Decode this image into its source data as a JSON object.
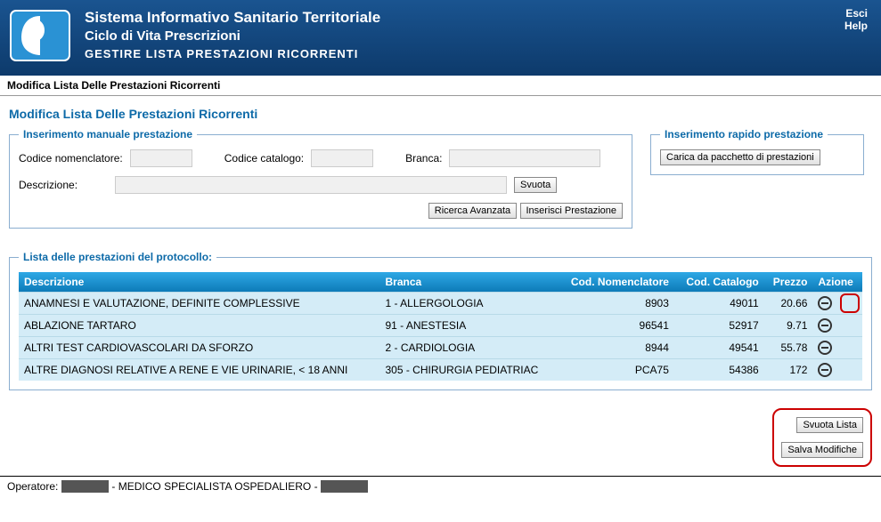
{
  "header": {
    "title": "Sistema Informativo Sanitario Territoriale",
    "subtitle": "Ciclo di Vita Prescrizioni",
    "section": "GESTIRE LISTA PRESTAZIONI RICORRENTI",
    "exit": "Esci",
    "help": "Help"
  },
  "breadcrumb": "Modifica Lista Delle Prestazioni Ricorrenti",
  "page_title": "Modifica Lista Delle Prestazioni Ricorrenti",
  "insert": {
    "legend": "Inserimento manuale prestazione",
    "codice_nomenclatore_label": "Codice nomenclatore:",
    "codice_catalogo_label": "Codice catalogo:",
    "branca_label": "Branca:",
    "descrizione_label": "Descrizione:",
    "svuota": "Svuota",
    "ricerca_avanzata": "Ricerca Avanzata",
    "inserisci_prestazione": "Inserisci Prestazione"
  },
  "rapido": {
    "legend": "Inserimento rapido prestazione",
    "carica": "Carica da pacchetto di prestazioni"
  },
  "table": {
    "legend": "Lista delle prestazioni del protocollo:",
    "headers": {
      "descrizione": "Descrizione",
      "branca": "Branca",
      "cod_nomenclatore": "Cod. Nomenclatore",
      "cod_catalogo": "Cod. Catalogo",
      "prezzo": "Prezzo",
      "azione": "Azione"
    },
    "rows": [
      {
        "descrizione": "ANAMNESI E VALUTAZIONE, DEFINITE COMPLESSIVE",
        "branca": "1 - ALLERGOLOGIA",
        "cod_nom": "8903",
        "cod_cat": "49011",
        "prezzo": "20.66",
        "highlight": true
      },
      {
        "descrizione": "ABLAZIONE TARTARO",
        "branca": "91 - ANESTESIA",
        "cod_nom": "96541",
        "cod_cat": "52917",
        "prezzo": "9.71",
        "highlight": false
      },
      {
        "descrizione": "ALTRI TEST CARDIOVASCOLARI DA SFORZO",
        "branca": "2 - CARDIOLOGIA",
        "cod_nom": "8944",
        "cod_cat": "49541",
        "prezzo": "55.78",
        "highlight": false
      },
      {
        "descrizione": "ALTRE DIAGNOSI RELATIVE A RENE E VIE URINARIE, < 18 ANNI",
        "branca": "305 - CHIRURGIA PEDIATRIAC",
        "cod_nom": "PCA75",
        "cod_cat": "54386",
        "prezzo": "172",
        "highlight": false
      }
    ]
  },
  "actions": {
    "svuota_lista": "Svuota Lista",
    "salva_modifiche": "Salva Modifiche"
  },
  "status": {
    "operatore_label": "Operatore:",
    "role": "MEDICO SPECIALISTA OSPEDALIERO"
  }
}
